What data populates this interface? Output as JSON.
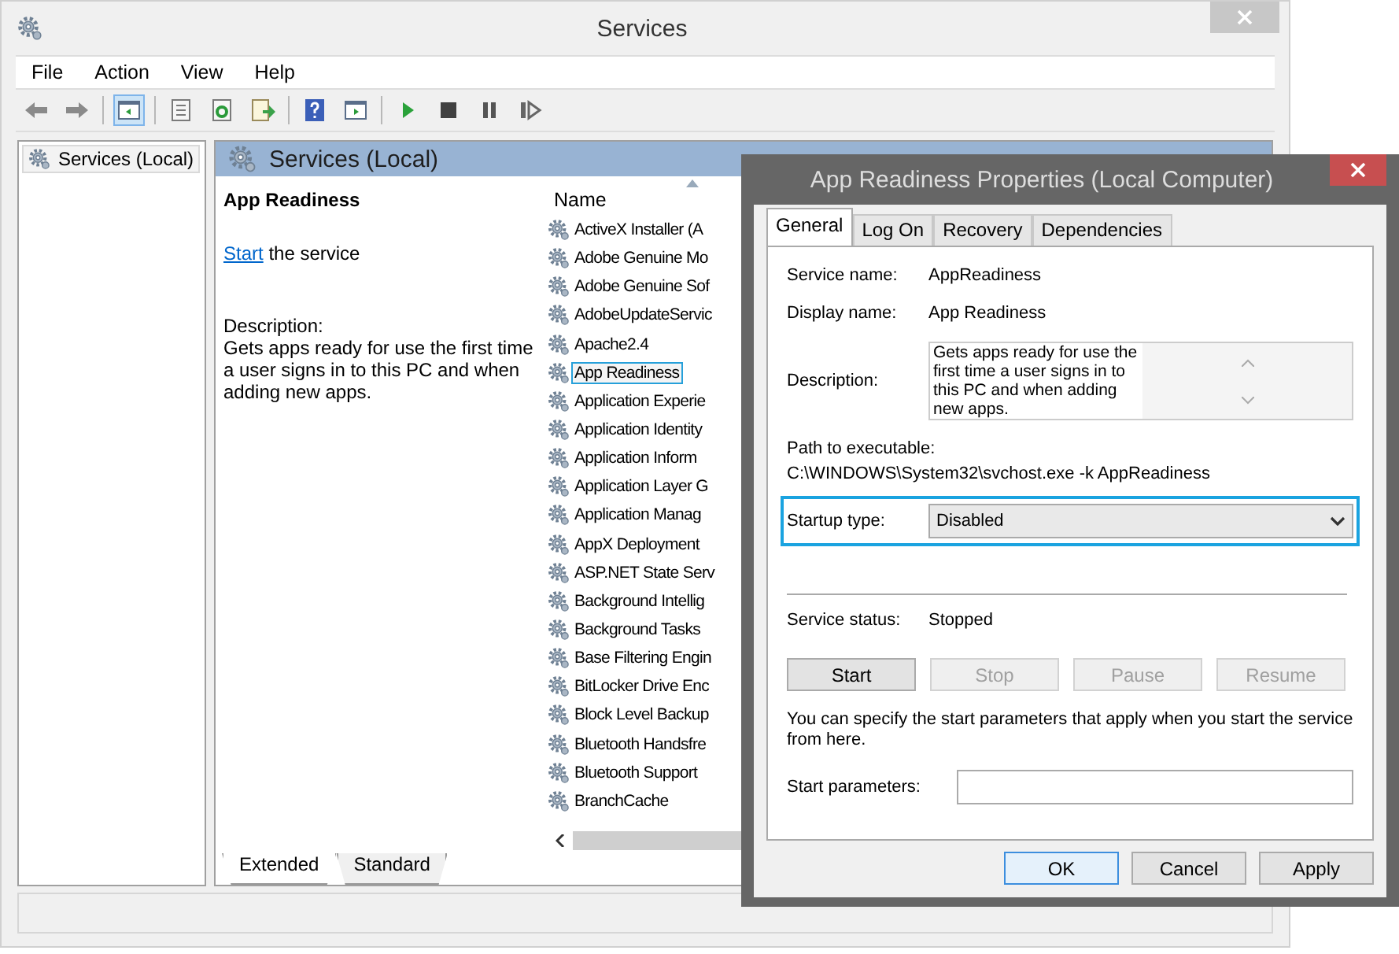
{
  "window": {
    "title": "Services"
  },
  "menu": [
    "File",
    "Action",
    "View",
    "Help"
  ],
  "tree": [
    {
      "label": "Services (Local)",
      "selected": true
    }
  ],
  "panel": {
    "header": "Services (Local)",
    "details": {
      "title": "App Readiness",
      "link": "Start",
      "link_rest": "the service",
      "description_label": "Description:",
      "description": "Gets apps ready for use the first time a user signs in to this PC and when adding new apps."
    },
    "list": {
      "column": "Name",
      "rows": [
        {
          "name": "ActiveX Installer (A",
          "selected": false
        },
        {
          "name": "Adobe Genuine Mo",
          "selected": false
        },
        {
          "name": "Adobe Genuine Sof",
          "selected": false
        },
        {
          "name": "AdobeUpdateServic",
          "selected": false
        },
        {
          "name": "Apache2.4",
          "selected": false
        },
        {
          "name": "App Readiness",
          "selected": true
        },
        {
          "name": "Application Experie",
          "selected": false
        },
        {
          "name": "Application Identity",
          "selected": false
        },
        {
          "name": "Application Inform",
          "selected": false
        },
        {
          "name": "Application Layer G",
          "selected": false
        },
        {
          "name": "Application Manag",
          "selected": false
        },
        {
          "name": "AppX Deployment",
          "selected": false
        },
        {
          "name": "ASP.NET State Serv",
          "selected": false
        },
        {
          "name": "Background Intellig",
          "selected": false
        },
        {
          "name": "Background Tasks",
          "selected": false
        },
        {
          "name": "Base Filtering Engin",
          "selected": false
        },
        {
          "name": "BitLocker Drive Enc",
          "selected": false
        },
        {
          "name": "Block Level Backup",
          "selected": false
        },
        {
          "name": "Bluetooth Handsfre",
          "selected": false
        },
        {
          "name": "Bluetooth Support",
          "selected": false
        },
        {
          "name": "BranchCache",
          "selected": false
        }
      ]
    },
    "view_tabs": [
      {
        "label": "Extended",
        "selected": true
      },
      {
        "label": "Standard",
        "selected": false
      }
    ]
  },
  "dialog": {
    "title": "App Readiness Properties (Local Computer)",
    "tabs": [
      {
        "label": "General",
        "selected": true
      },
      {
        "label": "Log On",
        "selected": false
      },
      {
        "label": "Recovery",
        "selected": false
      },
      {
        "label": "Dependencies",
        "selected": false
      }
    ],
    "service_name": {
      "label": "Service name:",
      "value": "AppReadiness"
    },
    "display_name": {
      "label": "Display name:",
      "value": "App Readiness"
    },
    "description": {
      "label": "Description:",
      "value": "Gets apps ready for use the first time a user signs in to this PC and when adding new apps."
    },
    "path": {
      "label": "Path to executable:",
      "value": "C:\\WINDOWS\\System32\\svchost.exe -k AppReadiness"
    },
    "startup_type": {
      "label": "Startup type:",
      "value": "Disabled"
    },
    "service_status": {
      "label": "Service status:",
      "value": "Stopped"
    },
    "controls": [
      {
        "label": "Start",
        "disabled": false
      },
      {
        "label": "Stop",
        "disabled": true
      },
      {
        "label": "Pause",
        "disabled": true
      },
      {
        "label": "Resume",
        "disabled": true
      }
    ],
    "note": "You can specify the start parameters that apply when you start the service from here.",
    "start_parameters": {
      "label": "Start parameters:"
    },
    "buttons": [
      {
        "label": "OK",
        "default": true
      },
      {
        "label": "Cancel",
        "default": false
      },
      {
        "label": "Apply",
        "default": false
      }
    ]
  }
}
